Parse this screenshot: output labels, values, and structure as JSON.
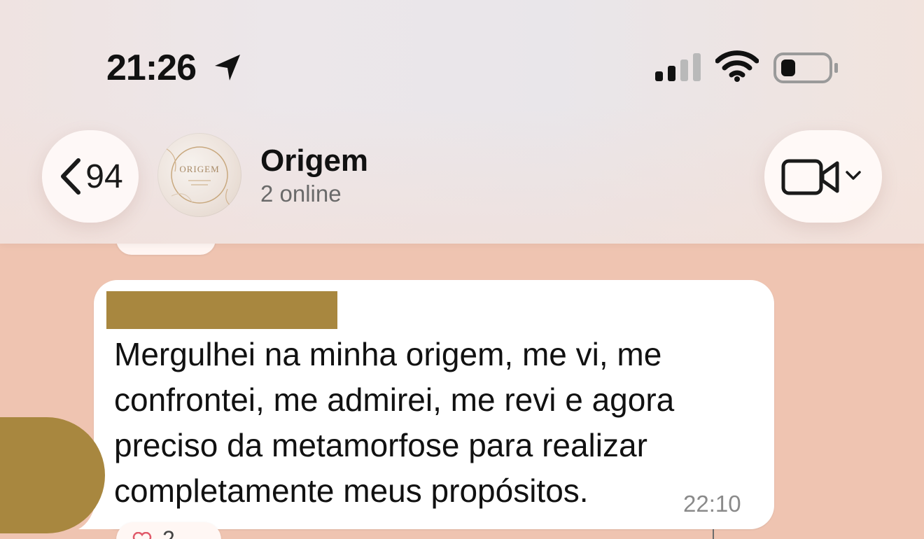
{
  "status_bar": {
    "time": "21:26",
    "location_icon": "location-arrow-icon",
    "signal_icon": "cellular-signal-icon",
    "wifi_icon": "wifi-icon",
    "battery_icon": "battery-low-icon"
  },
  "nav": {
    "back_icon": "chevron-left-icon",
    "back_count": "94",
    "chat_title": "Origem",
    "chat_subtitle": "2 online",
    "avatar_text": "ORIGEM",
    "video_icon": "video-camera-icon",
    "video_menu_icon": "chevron-down-icon"
  },
  "message": {
    "sender": "",
    "text": "Mergulhei na minha origem, me vi, me confrontei,  me admirei, me revi e agora preciso da metamorfose para realizar completamente meus propósitos.",
    "time": "22:10",
    "reaction_icon": "heart-icon",
    "reaction_count": "2"
  },
  "colors": {
    "chat_background": "#efc4b1",
    "bubble": "#ffffff",
    "redaction": "#a8873f"
  }
}
